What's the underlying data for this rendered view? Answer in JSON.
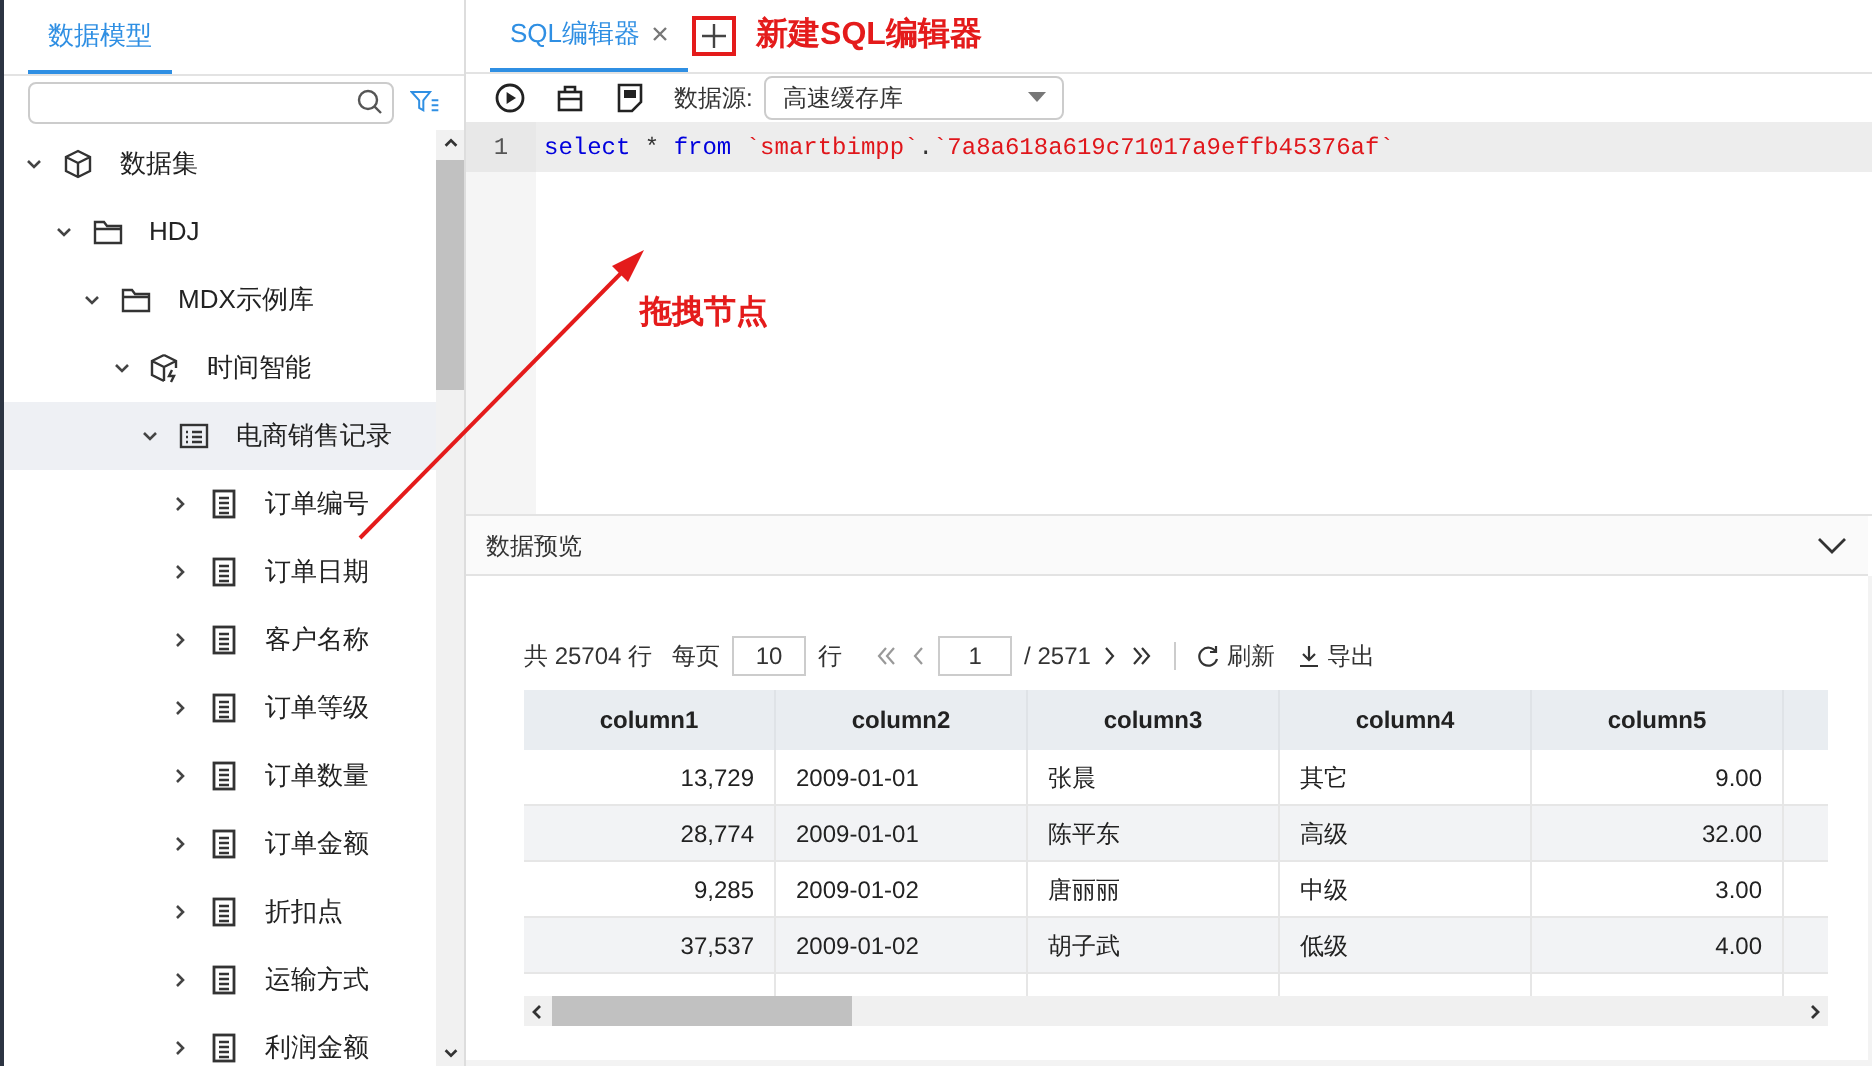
{
  "left_panel": {
    "tab": "数据模型",
    "tree": [
      {
        "label": "数据集",
        "kind": "dataset",
        "expanded": true,
        "selected": false,
        "children": [
          {
            "label": "HDJ",
            "kind": "folder",
            "expanded": true,
            "selected": false,
            "children": [
              {
                "label": "MDX示例库",
                "kind": "folder",
                "expanded": true,
                "selected": false,
                "children": [
                  {
                    "label": "时间智能",
                    "kind": "cube",
                    "expanded": true,
                    "selected": false,
                    "children": [
                      {
                        "label": "电商销售记录",
                        "kind": "table",
                        "expanded": true,
                        "selected": true,
                        "children": [
                          {
                            "label": "订单编号",
                            "kind": "field",
                            "expanded": false,
                            "selected": false
                          },
                          {
                            "label": "订单日期",
                            "kind": "field",
                            "expanded": false,
                            "selected": false
                          },
                          {
                            "label": "客户名称",
                            "kind": "field",
                            "expanded": false,
                            "selected": false
                          },
                          {
                            "label": "订单等级",
                            "kind": "field",
                            "expanded": false,
                            "selected": false
                          },
                          {
                            "label": "订单数量",
                            "kind": "field",
                            "expanded": false,
                            "selected": false
                          },
                          {
                            "label": "订单金额",
                            "kind": "field",
                            "expanded": false,
                            "selected": false
                          },
                          {
                            "label": "折扣点",
                            "kind": "field",
                            "expanded": false,
                            "selected": false
                          },
                          {
                            "label": "运输方式",
                            "kind": "field",
                            "expanded": false,
                            "selected": false
                          },
                          {
                            "label": "利润金额",
                            "kind": "field",
                            "expanded": false,
                            "selected": false
                          }
                        ]
                      }
                    ]
                  }
                ]
              }
            ]
          }
        ]
      }
    ]
  },
  "editor": {
    "tab": "SQL编辑器",
    "new_tab_annotation": "新建SQL编辑器",
    "datasource_label": "数据源:",
    "datasource": "高速缓存库",
    "lines": [
      {
        "number": "1",
        "tokens": [
          {
            "text": "select",
            "kind": "keyword"
          },
          {
            "text": " * ",
            "kind": "plain"
          },
          {
            "text": "from ",
            "kind": "keyword"
          },
          {
            "text": "`smartbimpp`",
            "kind": "string"
          },
          {
            "text": ".",
            "kind": "plain"
          },
          {
            "text": "`7a8a618a619c71017a9effb45376af`",
            "kind": "string"
          }
        ]
      }
    ],
    "drag_annotation": "拖拽节点"
  },
  "preview": {
    "title": "数据预览",
    "pager": {
      "total": "共 25704 行",
      "per_page_label": "每页",
      "per_page": "10",
      "rows_unit": "行",
      "page": "1",
      "page_count": "/ 2571",
      "refresh": "刷新",
      "export": "导出"
    },
    "table": {
      "columns": [
        "column1",
        "column2",
        "column3",
        "column4",
        "column5"
      ],
      "rows": [
        [
          "13,729",
          "2009-01-01",
          "张晨",
          "其它",
          "9.00"
        ],
        [
          "28,774",
          "2009-01-01",
          "陈平东",
          "高级",
          "32.00"
        ],
        [
          "9,285",
          "2009-01-02",
          "唐丽丽",
          "中级",
          "3.00"
        ],
        [
          "37,537",
          "2009-01-02",
          "胡子武",
          "低级",
          "4.00"
        ]
      ]
    }
  }
}
